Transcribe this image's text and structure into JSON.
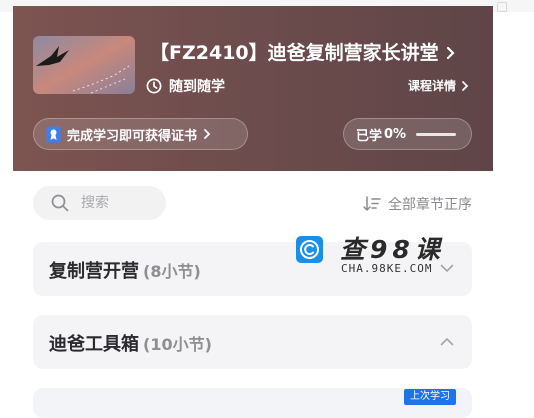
{
  "header": {
    "course_title": "【FZ2410】迪爸复制营家长讲堂",
    "learn_mode": "随到随学",
    "detail_link": "课程详情",
    "certificate_text": "完成学习即可获得证书",
    "progress_label": "已学",
    "progress_value": "0%",
    "progress_fraction": 0
  },
  "toolbar": {
    "search_placeholder": "搜索",
    "sort_label": "全部章节正序"
  },
  "sections": [
    {
      "title": "复制营开营",
      "count": "(8小节)",
      "state": "collapsed"
    },
    {
      "title": "迪爸工具箱",
      "count": "(10小节)",
      "state": "expanded"
    }
  ],
  "lesson": {
    "badge": "上次学习"
  },
  "watermark": {
    "title": "查98课",
    "subtitle": "CHA.98KE.COM"
  },
  "icons": [
    "clock-icon",
    "certificate-icon",
    "search-icon",
    "sort-icon",
    "chevron-right-icon",
    "chevron-down-icon",
    "chevron-up-icon"
  ],
  "colors": {
    "header_bg": "#6e4d4d",
    "accent_blue": "#1e73e8",
    "section_bg": "#f4f4f6",
    "muted_text": "#8e8e93"
  }
}
